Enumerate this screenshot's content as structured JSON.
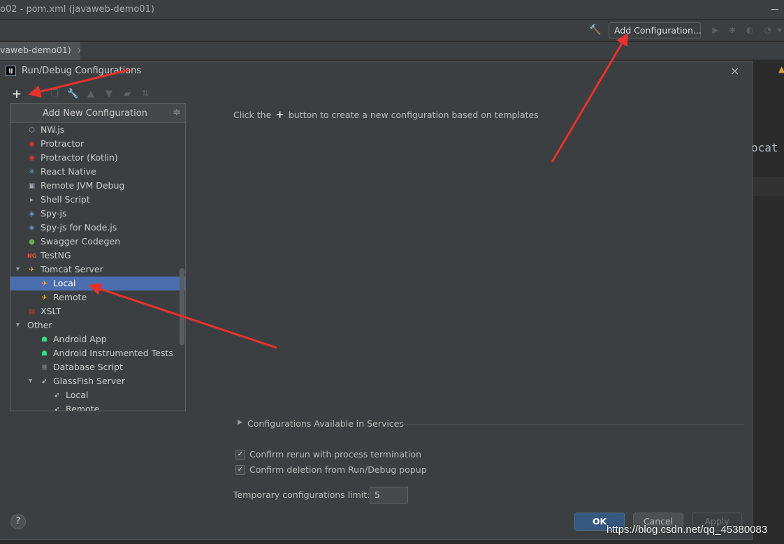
{
  "window": {
    "title": "o02 - pom.xml (javaweb-demo01)",
    "tab_label": "vaweb-demo01)",
    "tab_close": "×"
  },
  "toolbar": {
    "add_configuration_label": "Add Configuration..."
  },
  "editor": {
    "visible_text": "ocat"
  },
  "dialog": {
    "title": "Run/Debug Configurations",
    "close": "×",
    "logo_text": "IJ",
    "tools": {
      "add": "+"
    },
    "popup": {
      "header": "Add New Configuration",
      "items": [
        {
          "label": "NW.js",
          "icon": "nwjs-icon",
          "icon_glyph": "⬡",
          "icon_color": "#8aa4c4"
        },
        {
          "label": "Protractor",
          "icon": "protractor-icon",
          "icon_glyph": "◉",
          "icon_color": "#e23237"
        },
        {
          "label": "Protractor (Kotlin)",
          "icon": "protractor-kotlin-icon",
          "icon_glyph": "◉",
          "icon_color": "#e23237"
        },
        {
          "label": "React Native",
          "icon": "react-icon",
          "icon_glyph": "⚛",
          "icon_color": "#61dafb"
        },
        {
          "label": "Remote JVM Debug",
          "icon": "remote-debug-icon",
          "icon_glyph": "▣",
          "icon_color": "#9aa7b0"
        },
        {
          "label": "Shell Script",
          "icon": "shell-icon",
          "icon_glyph": "▸",
          "icon_color": "#9aa7b0"
        },
        {
          "label": "Spy-js",
          "icon": "spyjs-icon",
          "icon_glyph": "◈",
          "icon_color": "#6a9fd4"
        },
        {
          "label": "Spy-js for Node.js",
          "icon": "spyjs-node-icon",
          "icon_glyph": "◈",
          "icon_color": "#6a9fd4"
        },
        {
          "label": "Swagger Codegen",
          "icon": "swagger-icon",
          "icon_glyph": "●",
          "icon_color": "#6ab04c"
        },
        {
          "label": "TestNG",
          "icon": "testng-icon",
          "icon_glyph": "NG",
          "icon_color": "#d65c3b"
        },
        {
          "label": "Tomcat Server",
          "icon": "tomcat-icon",
          "icon_glyph": "✈",
          "icon_color": "#e0b24a"
        },
        {
          "label": "Local",
          "icon": "tomcat-local-icon",
          "icon_glyph": "✈",
          "icon_color": "#e0b24a"
        },
        {
          "label": "Remote",
          "icon": "tomcat-remote-icon",
          "icon_glyph": "✈",
          "icon_color": "#e0b24a"
        },
        {
          "label": "XSLT",
          "icon": "xslt-icon",
          "icon_glyph": "▤",
          "icon_color": "#c0392b"
        },
        {
          "label": "Other",
          "icon": "",
          "icon_glyph": "",
          "icon_color": ""
        },
        {
          "label": "Android App",
          "icon": "android-icon",
          "icon_glyph": "☗",
          "icon_color": "#3ddc84"
        },
        {
          "label": "Android Instrumented Tests",
          "icon": "android-tests-icon",
          "icon_glyph": "☗",
          "icon_color": "#3ddc84"
        },
        {
          "label": "Database Script",
          "icon": "database-icon",
          "icon_glyph": "≣",
          "icon_color": "#9aa7b0"
        },
        {
          "label": "GlassFish Server",
          "icon": "glassfish-icon",
          "icon_glyph": "➶",
          "icon_color": "#dddddd"
        },
        {
          "label": "Local",
          "icon": "glassfish-local-icon",
          "icon_glyph": "➶",
          "icon_color": "#dddddd"
        },
        {
          "label": "Remote",
          "icon": "glassfish-remote-icon",
          "icon_glyph": "➶",
          "icon_color": "#dddddd"
        }
      ]
    },
    "hint_prefix": "Click the",
    "hint_plus": "+",
    "hint_suffix": "button to create a new configuration based on templates",
    "services_label": "Configurations Available in Services",
    "confirm_rerun_label": "Confirm rerun with process termination",
    "confirm_deletion_label": "Confirm deletion from Run/Debug popup",
    "temp_limit_label": "Temporary configurations limit:",
    "temp_limit_value": "5",
    "help": "?",
    "ok_label": "OK",
    "cancel_label": "Cancel",
    "apply_label": "Apply"
  },
  "watermark": "https://blog.csdn.net/qq_45380083",
  "colors": {
    "selection": "#4b6eaf",
    "arrow": "#e8312c",
    "ok_button": "#365880"
  }
}
